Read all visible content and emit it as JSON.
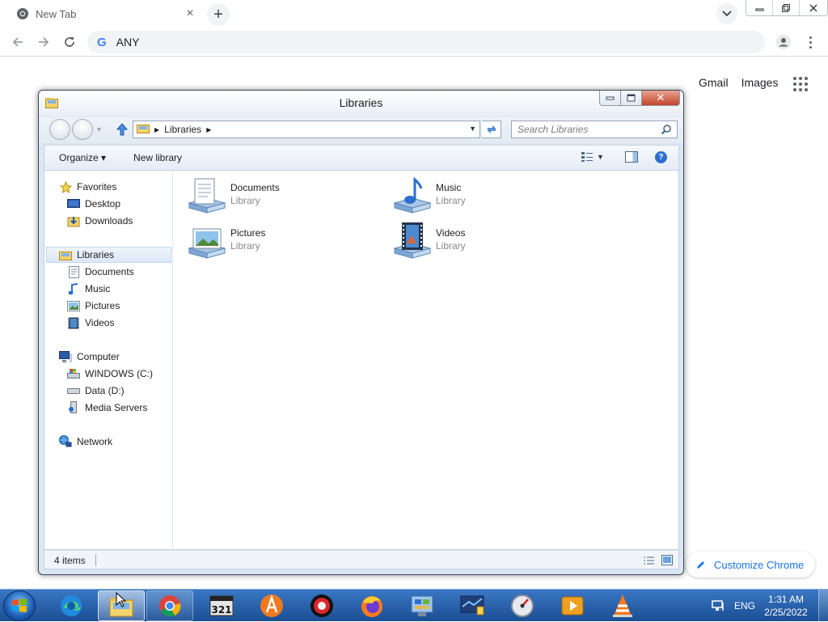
{
  "browser": {
    "tab": {
      "title": "New Tab",
      "close_glyph": "×"
    },
    "new_tab_glyph": "+",
    "omnibox": {
      "engine_letter": "G",
      "text": "ANY"
    },
    "window_controls": {
      "minimize": "—",
      "restore": "❐",
      "close": "✕"
    }
  },
  "ntp": {
    "links": [
      "Gmail",
      "Images"
    ],
    "customize_label": "Customize Chrome"
  },
  "explorer": {
    "window_title": "Libraries",
    "address": {
      "crumbs": [
        "Libraries"
      ]
    },
    "search_placeholder": "Search Libraries",
    "commands": {
      "organize": "Organize ▾",
      "new_library": "New library"
    },
    "nav": {
      "favorites": {
        "label": "Favorites",
        "items": [
          "Desktop",
          "Downloads"
        ]
      },
      "libraries": {
        "label": "Libraries",
        "items": [
          "Documents",
          "Music",
          "Pictures",
          "Videos"
        ]
      },
      "computer": {
        "label": "Computer",
        "items": [
          "WINDOWS (C:)",
          "Data (D:)",
          "Media Servers"
        ]
      },
      "network": {
        "label": "Network"
      }
    },
    "files": [
      {
        "name": "Documents",
        "type": "Library",
        "icon": "documents-library-icon"
      },
      {
        "name": "Music",
        "type": "Library",
        "icon": "music-library-icon"
      },
      {
        "name": "Pictures",
        "type": "Library",
        "icon": "pictures-library-icon"
      },
      {
        "name": "Videos",
        "type": "Library",
        "icon": "videos-library-icon"
      }
    ],
    "status": {
      "count": "4 items"
    },
    "close_glyph": "✕"
  },
  "taskbar": {
    "items": [
      {
        "name": "edge-icon"
      },
      {
        "name": "file-explorer-icon",
        "state": "active"
      },
      {
        "name": "chrome-icon",
        "state": "running"
      },
      {
        "name": "media-player-classic-icon"
      },
      {
        "name": "aimp-icon"
      },
      {
        "name": "screen-recorder-icon"
      },
      {
        "name": "firefox-icon"
      },
      {
        "name": "control-panel-icon"
      },
      {
        "name": "system-config-icon"
      },
      {
        "name": "speedometer-icon"
      },
      {
        "name": "presentation-player-icon"
      },
      {
        "name": "vlc-icon"
      }
    ],
    "tray": {
      "language": "ENG",
      "time": "1:31 AM",
      "date": "2/25/2022"
    }
  },
  "colors": {
    "chrome_accent": "#1a73e8",
    "taskbar_top": "#3a77c4",
    "taskbar_bottom": "#1b4e93",
    "explorer_close": "#c2452d"
  }
}
